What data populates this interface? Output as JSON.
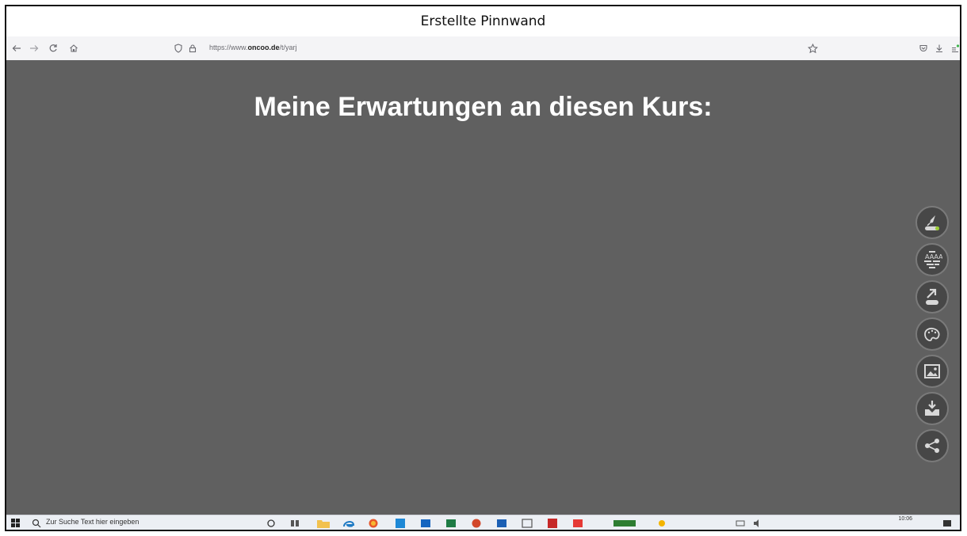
{
  "window": {
    "title": "Erstellte Pinnwand"
  },
  "browser": {
    "url_prefix": "https://www.",
    "url_domain": "oncoo.de",
    "url_path": "/t/yarj"
  },
  "board": {
    "title": "Meine Erwartungen an diesen Kurs:"
  },
  "toolbar": {
    "tools": [
      "rocket-icon",
      "text-format-icon",
      "export-icon",
      "palette-icon",
      "image-icon",
      "download-icon",
      "share-icon"
    ]
  },
  "taskbar": {
    "search_placeholder": "Zur Suche Text hier eingeben",
    "time": "10:06"
  },
  "colors": {
    "board_background": "#606060",
    "tool_background": "#474747",
    "accent_green": "#9acd32"
  }
}
